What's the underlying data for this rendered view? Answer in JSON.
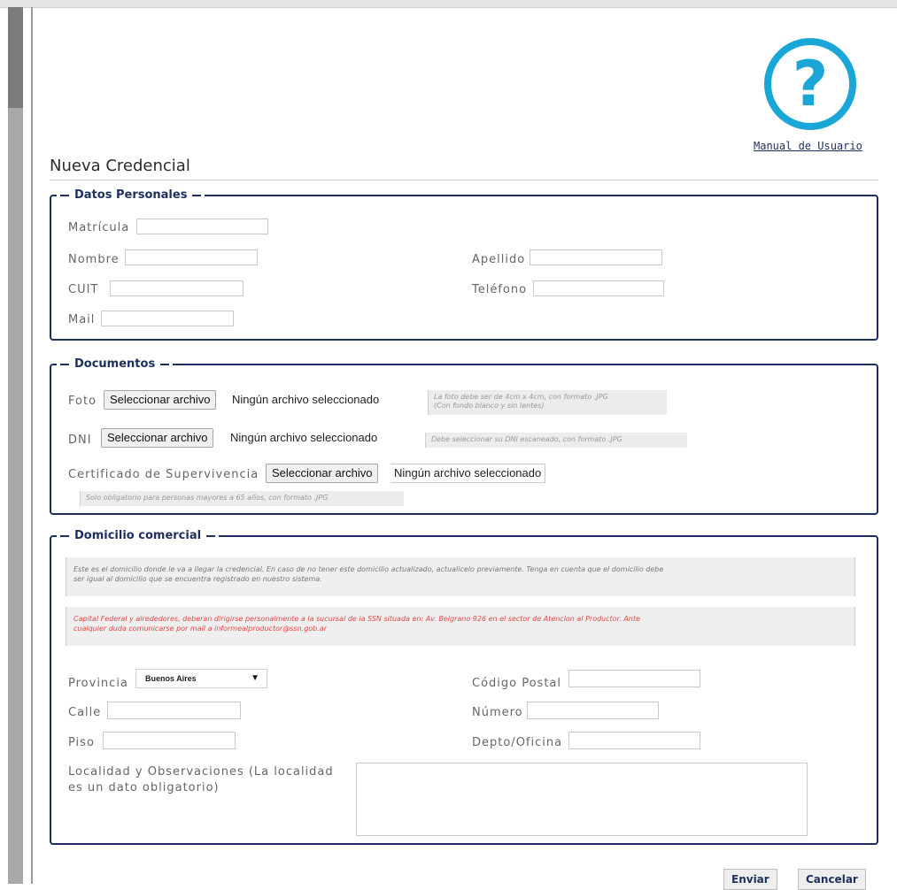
{
  "header": {
    "help_icon_glyph": "?",
    "help_icon_color": "#1aa6d6",
    "manual_link": "Manual de Usuario",
    "title": "Nueva Credencial"
  },
  "datos_personales": {
    "legend": "Datos Personales",
    "matricula": {
      "label": "Matrícula",
      "value": ""
    },
    "nombre": {
      "label": "Nombre",
      "value": ""
    },
    "apellido": {
      "label": "Apellido",
      "value": ""
    },
    "cuit": {
      "label": "CUIT",
      "value": ""
    },
    "telefono": {
      "label": "Teléfono",
      "value": ""
    },
    "mail": {
      "label": "Mail",
      "value": ""
    }
  },
  "documentos": {
    "legend": "Documentos",
    "foto": {
      "label": "Foto",
      "button": "Seleccionar archivo",
      "status": "Ningún archivo seleccionado",
      "note_line1": "La foto debe ser de 4cm x 4cm, con formato .JPG",
      "note_line2": "(Con fondo blanco y sin lentes)"
    },
    "dni": {
      "label": "DNI",
      "button": "Seleccionar archivo",
      "status": "Ningún archivo seleccionado",
      "note": "Debe seleccionar su DNI escaneado, con formato .JPG"
    },
    "certificado": {
      "label": "Certificado de Supervivencia",
      "button": "Seleccionar archivo",
      "status": "Ningún archivo seleccionado",
      "note": "Solo obligatorio para personas mayores a 65 años, con formato .JPG"
    }
  },
  "domicilio": {
    "legend": "Domicilio comercial",
    "info_line1": "Este es el domicilio donde le va a llegar la credencial. En caso de no tener este domicilio actualizado, actualicelo previamente. Tenga en cuenta que el domicilio debe",
    "info_line2": "ser igual al domicilio que se encuentra registrado en nuestro sistema.",
    "warning_line1": "Capital Federal y alrededores, deberan dirigirse personalmente a la sucursal de la SSN situada en: Av. Belgrano 926 en el sector de Atencion al Productor. Ante",
    "warning_line2": "cualquier duda comunicarse por mail a informealproductor@ssn.gob.ar",
    "warning_color": "#e04848",
    "provincia": {
      "label": "Provincia",
      "selected": "Buenos Aires"
    },
    "codigo_postal": {
      "label": "Código Postal",
      "value": ""
    },
    "calle": {
      "label": "Calle",
      "value": ""
    },
    "numero": {
      "label": "Número",
      "value": ""
    },
    "piso": {
      "label": "Piso",
      "value": ""
    },
    "depto": {
      "label": "Depto/Oficina",
      "value": ""
    },
    "localidad": {
      "label_line1": "Localidad y Observaciones (La localidad",
      "label_line2": "es un dato obligatorio)",
      "value": ""
    }
  },
  "actions": {
    "enviar": "Enviar",
    "cancelar": "Cancelar"
  }
}
